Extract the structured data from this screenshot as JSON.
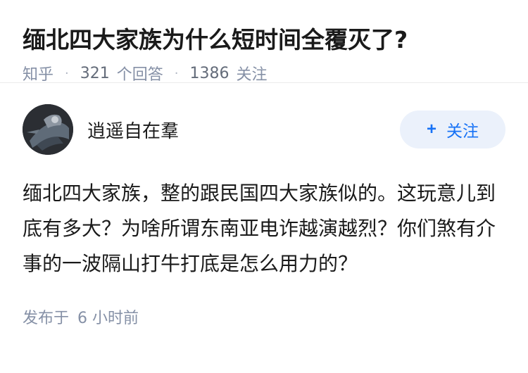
{
  "question": {
    "title": "缅北四大家族为什么短时间全覆灭了?",
    "source": "知乎",
    "separator": "·",
    "answer_count": "321",
    "answer_label": "个回答",
    "follower_count": "1386",
    "follower_label": "关注"
  },
  "answer": {
    "author_name": "逍遥自在羣",
    "follow_plus": "+",
    "follow_label": "关注",
    "content": "缅北四大家族，整的跟民国四大家族似的。这玩意儿到底有多大？为啥所谓东南亚电诈越演越烈？你们煞有介事的一波隔山打牛打底是怎么用力的？",
    "published_label": "发布于",
    "published_time": "6 小时前"
  },
  "colors": {
    "text_primary": "#1a1a1a",
    "text_secondary": "#8590a6",
    "accent_blue": "#1772f6",
    "button_bg": "#ebf1fb",
    "divider": "#ebebeb"
  }
}
